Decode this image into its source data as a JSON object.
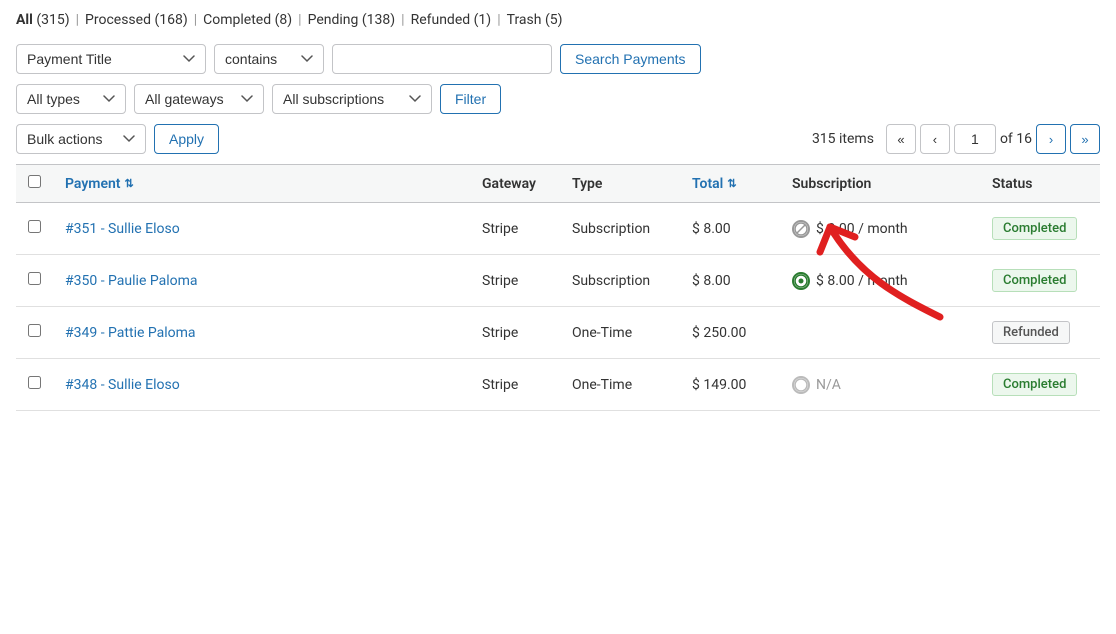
{
  "filter_tabs": {
    "all": {
      "label": "All",
      "count": "(315)",
      "active": true
    },
    "processed": {
      "label": "Processed",
      "count": "(168)"
    },
    "completed": {
      "label": "Completed",
      "count": "(8)"
    },
    "pending": {
      "label": "Pending",
      "count": "(138)"
    },
    "refunded": {
      "label": "Refunded",
      "count": "(1)"
    },
    "trash": {
      "label": "Trash",
      "count": "(5)"
    }
  },
  "toolbar": {
    "payment_title_label": "Payment Title",
    "contains_label": "contains",
    "search_placeholder": "",
    "search_button_label": "Search Payments",
    "all_types_label": "All types",
    "all_gateways_label": "All gateways",
    "all_subscriptions_label": "All subscriptions",
    "filter_button_label": "Filter",
    "bulk_actions_label": "Bulk actions",
    "apply_button_label": "Apply"
  },
  "pagination": {
    "items_count": "315 items",
    "current_page": "1",
    "total_pages": "of 16",
    "first_label": "«",
    "prev_label": "‹",
    "next_label": "›",
    "last_label": "»"
  },
  "table": {
    "columns": {
      "payment": "Payment",
      "gateway": "Gateway",
      "type": "Type",
      "total": "Total",
      "subscription": "Subscription",
      "status": "Status"
    },
    "rows": [
      {
        "id": "#351 - Sullie Eloso",
        "gateway": "Stripe",
        "type": "Subscription",
        "total": "$ 8.00",
        "sub_icon": "cancelled",
        "subscription": "$ 8.00 / month",
        "status": "Completed",
        "status_type": "completed"
      },
      {
        "id": "#350 - Paulie Paloma",
        "gateway": "Stripe",
        "type": "Subscription",
        "total": "$ 8.00",
        "sub_icon": "active",
        "subscription": "$ 8.00 / month",
        "status": "Completed",
        "status_type": "completed"
      },
      {
        "id": "#349 - Pattie Paloma",
        "gateway": "Stripe",
        "type": "One-Time",
        "total": "$ 250.00",
        "sub_icon": "none",
        "subscription": "",
        "status": "Refunded",
        "status_type": "refunded"
      },
      {
        "id": "#348 - Sullie Eloso",
        "gateway": "Stripe",
        "type": "One-Time",
        "total": "$ 149.00",
        "sub_icon": "pending",
        "subscription": "N/A",
        "status": "Completed",
        "status_type": "completed"
      }
    ]
  }
}
